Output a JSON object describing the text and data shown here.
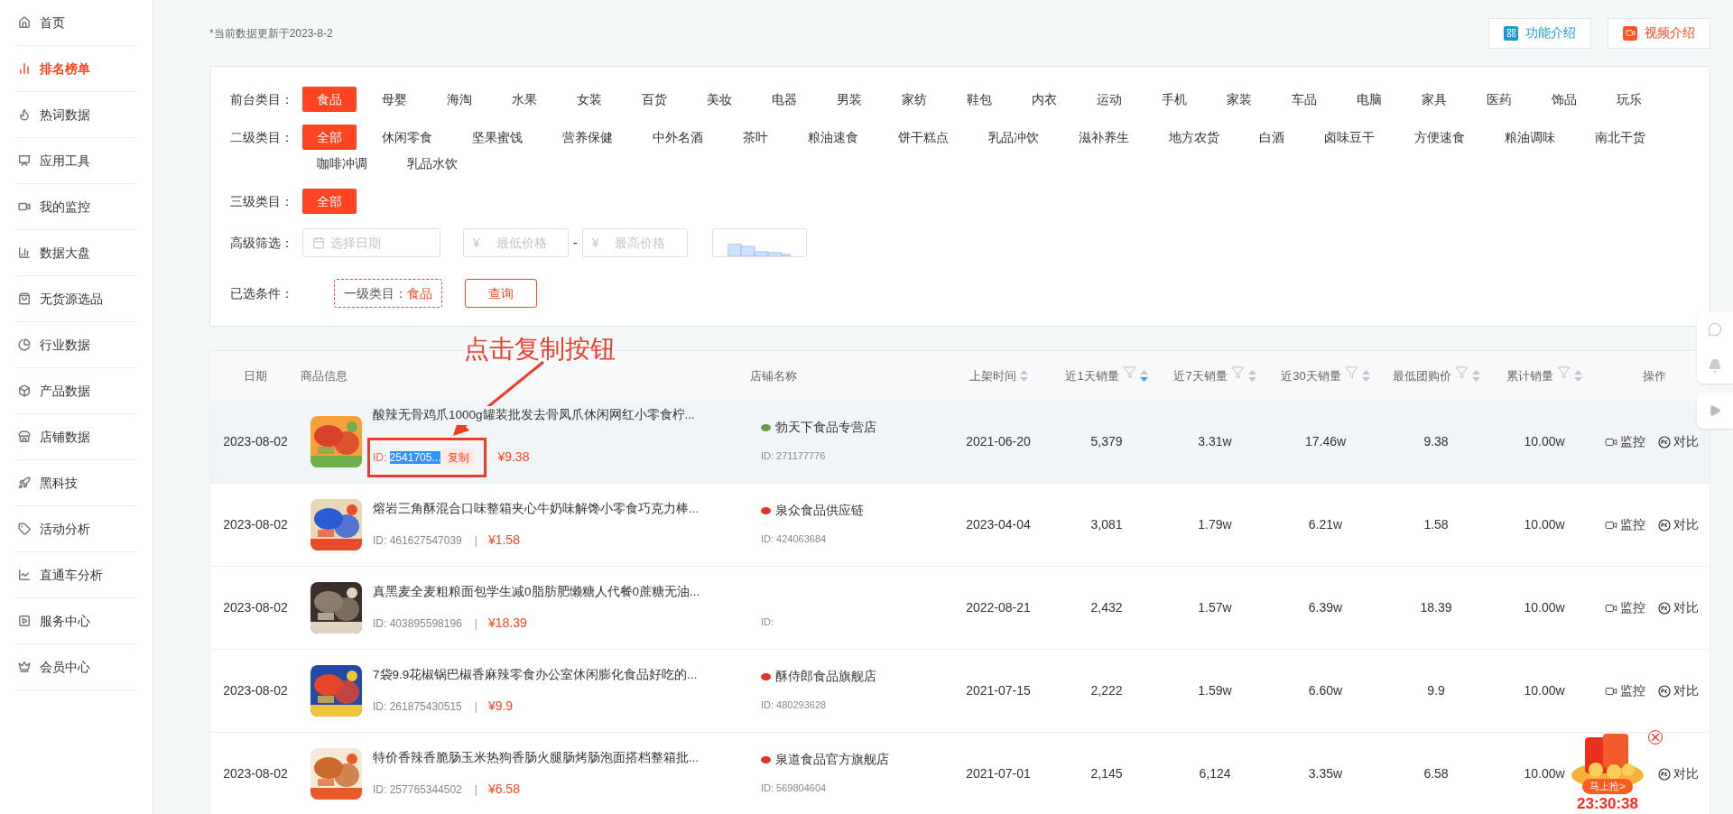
{
  "sidebar": {
    "items": [
      {
        "label": "首页",
        "selected": false
      },
      {
        "label": "排名榜单",
        "selected": true
      },
      {
        "label": "热词数据",
        "selected": false
      },
      {
        "label": "应用工具",
        "selected": false
      },
      {
        "label": "我的监控",
        "selected": false
      },
      {
        "label": "数据大盘",
        "selected": false
      },
      {
        "label": "无货源选品",
        "selected": false
      },
      {
        "label": "行业数据",
        "selected": false
      },
      {
        "label": "产品数据",
        "selected": false
      },
      {
        "label": "店铺数据",
        "selected": false
      },
      {
        "label": "黑科技",
        "selected": false
      },
      {
        "label": "活动分析",
        "selected": false
      },
      {
        "label": "直通车分析",
        "selected": false
      },
      {
        "label": "服务中心",
        "selected": false
      },
      {
        "label": "会员中心",
        "selected": false
      }
    ]
  },
  "update_note": "*当前数据更新于2023-8-2",
  "header_buttons": [
    {
      "kind": "features",
      "label": "功能介绍"
    },
    {
      "kind": "video",
      "label": "视频介绍"
    }
  ],
  "filters": {
    "rows": [
      {
        "label": "前台类目：",
        "options": [
          {
            "label": "食品",
            "selected": true
          },
          {
            "label": "母婴",
            "selected": false
          },
          {
            "label": "海淘",
            "selected": false
          },
          {
            "label": "水果",
            "selected": false
          },
          {
            "label": "女装",
            "selected": false
          },
          {
            "label": "百货",
            "selected": false
          },
          {
            "label": "美妆",
            "selected": false
          },
          {
            "label": "电器",
            "selected": false
          },
          {
            "label": "男装",
            "selected": false
          },
          {
            "label": "家纺",
            "selected": false
          },
          {
            "label": "鞋包",
            "selected": false
          },
          {
            "label": "内衣",
            "selected": false
          },
          {
            "label": "运动",
            "selected": false
          },
          {
            "label": "手机",
            "selected": false
          },
          {
            "label": "家装",
            "selected": false
          },
          {
            "label": "车品",
            "selected": false
          },
          {
            "label": "电脑",
            "selected": false
          },
          {
            "label": "家具",
            "selected": false
          },
          {
            "label": "医药",
            "selected": false
          },
          {
            "label": "饰品",
            "selected": false
          },
          {
            "label": "玩乐",
            "selected": false
          }
        ]
      },
      {
        "label": "二级类目：",
        "options": [
          {
            "label": "全部",
            "selected": true
          },
          {
            "label": "休闲零食",
            "selected": false
          },
          {
            "label": "坚果蜜饯",
            "selected": false
          },
          {
            "label": "营养保健",
            "selected": false
          },
          {
            "label": "中外名酒",
            "selected": false
          },
          {
            "label": "茶叶",
            "selected": false
          },
          {
            "label": "粮油速食",
            "selected": false
          },
          {
            "label": "饼干糕点",
            "selected": false
          },
          {
            "label": "乳品冲饮",
            "selected": false
          },
          {
            "label": "滋补养生",
            "selected": false
          },
          {
            "label": "地方农货",
            "selected": false
          },
          {
            "label": "白酒",
            "selected": false
          },
          {
            "label": "卤味豆干",
            "selected": false
          },
          {
            "label": "方便速食",
            "selected": false
          },
          {
            "label": "粮油调味",
            "selected": false
          },
          {
            "label": "南北干货",
            "selected": false
          },
          {
            "label": "咖啡冲调",
            "selected": false
          },
          {
            "label": "乳品水饮",
            "selected": false
          }
        ]
      },
      {
        "label": "三级类目：",
        "options": [
          {
            "label": "全部",
            "selected": true
          }
        ]
      }
    ],
    "advanced": {
      "label": "高级筛选：",
      "date_placeholder": "选择日期",
      "currency": "¥",
      "min_price_placeholder": "最低价格",
      "separator": "-",
      "max_price_placeholder": "最高价格"
    },
    "selected_conditions": {
      "label": "已选条件：",
      "tag_key": "一级类目：",
      "tag_value": "食品",
      "query_button": "查询"
    }
  },
  "annotation": {
    "text": "点击复制按钮"
  },
  "table": {
    "columns": [
      {
        "label": "日期"
      },
      {
        "label": "商品信息"
      },
      {
        "label": "店铺名称"
      },
      {
        "label": "上架时间",
        "filter": false,
        "sorted_desc": false
      },
      {
        "label": "近1天销量",
        "filter": true,
        "sorted_desc": true
      },
      {
        "label": "近7天销量",
        "filter": true,
        "sorted_desc": false
      },
      {
        "label": "近30天销量",
        "filter": true,
        "sorted_desc": false
      },
      {
        "label": "最低团购价",
        "filter": true,
        "sorted_desc": false
      },
      {
        "label": "累计销量",
        "filter": true,
        "sorted_desc": false
      },
      {
        "label": "操作"
      }
    ],
    "rows": [
      {
        "highlighted": true,
        "date": "2023-08-02",
        "title": "酸辣无骨鸡爪1000g罐装批发去骨凤爪休闲网红小零食柠...",
        "id_label": "ID:",
        "id_value": "2541705...",
        "id_selected": true,
        "annotated": true,
        "copy_button": "复制",
        "price": "¥9.38",
        "shop": "勃天下食品专营店",
        "shop_id": "ID: 271177776",
        "listed": "2021-06-20",
        "d1": "5,379",
        "d7": "3.31w",
        "d30": "17.46w",
        "min_price": "9.38",
        "total": "10.00w",
        "actions": [
          {
            "kind": "monitor",
            "label": "监控"
          },
          {
            "kind": "compare",
            "label": "对比"
          }
        ]
      },
      {
        "highlighted": false,
        "date": "2023-08-02",
        "title": "熔岩三角酥混合口味整箱夹心牛奶味解馋小零食巧克力棒...",
        "id_label": "ID:",
        "id_value": "461627547039",
        "id_selected": false,
        "annotated": false,
        "separator": "|",
        "price": "¥1.58",
        "shop": "泉众食品供应链",
        "shop_id": "ID: 424063684",
        "listed": "2023-04-04",
        "d1": "3,081",
        "d7": "1.79w",
        "d30": "6.21w",
        "min_price": "1.58",
        "total": "10.00w",
        "actions": [
          {
            "kind": "monitor",
            "label": "监控"
          },
          {
            "kind": "compare",
            "label": "对比"
          }
        ]
      },
      {
        "highlighted": false,
        "date": "2023-08-02",
        "title": "真黑麦全麦粗粮面包学生减0脂肪肥懒糖人代餐0蔗糖无油...",
        "id_label": "ID:",
        "id_value": "403895598196",
        "id_selected": false,
        "annotated": false,
        "separator": "|",
        "price": "¥18.39",
        "shop_id": "ID:",
        "listed": "2022-08-21",
        "d1": "2,432",
        "d7": "1.57w",
        "d30": "6.39w",
        "min_price": "18.39",
        "total": "10.00w",
        "actions": [
          {
            "kind": "monitor",
            "label": "监控"
          },
          {
            "kind": "compare",
            "label": "对比"
          }
        ]
      },
      {
        "highlighted": false,
        "date": "2023-08-02",
        "title": "7袋9.9花椒锅巴椒香麻辣零食办公室休闲膨化食品好吃的...",
        "id_label": "ID:",
        "id_value": "261875430515",
        "id_selected": false,
        "annotated": false,
        "separator": "|",
        "price": "¥9.9",
        "shop": "酥侍郎食品旗舰店",
        "shop_id": "ID: 480293628",
        "listed": "2021-07-15",
        "d1": "2,222",
        "d7": "1.59w",
        "d30": "6.60w",
        "min_price": "9.9",
        "total": "10.00w",
        "actions": [
          {
            "kind": "monitor",
            "label": "监控"
          },
          {
            "kind": "compare",
            "label": "对比"
          }
        ]
      },
      {
        "highlighted": false,
        "date": "2023-08-02",
        "title": "特价香辣香脆肠玉米热狗香肠火腿肠烤肠泡面搭档整箱批...",
        "id_label": "ID:",
        "id_value": "257765344502",
        "id_selected": false,
        "annotated": false,
        "separator": "|",
        "price": "¥6.58",
        "shop": "泉道食品官方旗舰店",
        "shop_id": "ID: 569804604",
        "listed": "2021-07-01",
        "d1": "2,145",
        "d7": "6,124",
        "d30": "3.35w",
        "min_price": "6.58",
        "total": "10.00w",
        "actions": [
          {
            "kind": "compare",
            "label": "对比"
          }
        ]
      }
    ]
  },
  "promo_widget": {
    "button": "马上抢>",
    "countdown": "23:30:38"
  }
}
